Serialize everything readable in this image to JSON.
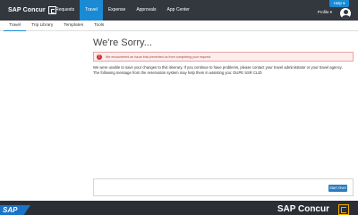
{
  "header": {
    "brand": "SAP Concur",
    "nav": [
      "Requests",
      "Travel",
      "Expense",
      "Approvals",
      "App Center"
    ],
    "active_nav": "Travel",
    "help_label": "Help ▾",
    "profile_label": "Profile ▾",
    "accent_color": "#1a8ad4"
  },
  "subnav": {
    "items": [
      "Travel",
      "Trip Library",
      "Templates",
      "Tools"
    ],
    "active": "Travel"
  },
  "main": {
    "title": "We're Sorry...",
    "error_text": "We encountered an issue that prevented us from completing your request.",
    "message_line1": "We were unable to save your changes to this itinerary. If you continue to have problems, please contact your travel administrator or your travel agency.",
    "message_line2": "The following message from the reservation system may help them in assisting you: DUPE SSR CLID",
    "start_over_label": "Start Over"
  },
  "footer": {
    "sap_label": "SAP",
    "brand": "SAP Concur"
  }
}
